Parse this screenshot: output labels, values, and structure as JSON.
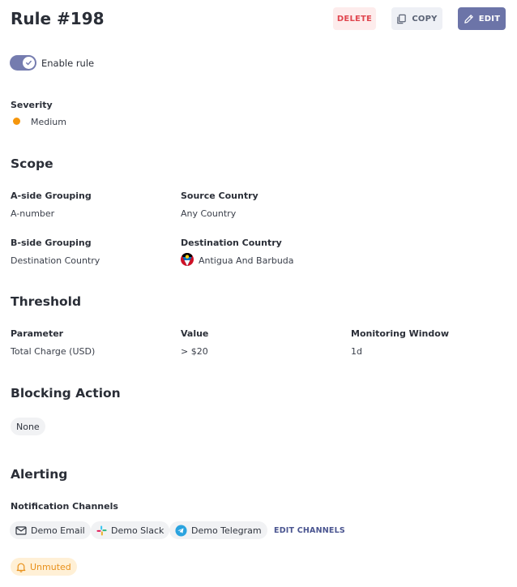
{
  "header": {
    "title": "Rule #198",
    "delete_label": "DELETE",
    "copy_label": "COPY",
    "edit_label": "EDIT"
  },
  "toggle": {
    "label": "Enable rule",
    "enabled": true
  },
  "severity": {
    "label": "Severity",
    "value": "Medium",
    "color": "#f5960c"
  },
  "scope": {
    "heading": "Scope",
    "a_side_label": "A-side Grouping",
    "a_side_value": "A-number",
    "source_country_label": "Source Country",
    "source_country_value": "Any Country",
    "b_side_label": "B-side Grouping",
    "b_side_value": "Destination Country",
    "destination_country_label": "Destination Country",
    "destination_country_value": "Antigua And Barbuda",
    "destination_flag_icon": "antigua-and-barbuda-flag-icon"
  },
  "threshold": {
    "heading": "Threshold",
    "parameter_label": "Parameter",
    "parameter_value": "Total Charge (USD)",
    "value_label": "Value",
    "value_value": "> $20",
    "window_label": "Monitoring Window",
    "window_value": "1d"
  },
  "blocking": {
    "heading": "Blocking Action",
    "value": "None"
  },
  "alerting": {
    "heading": "Alerting",
    "channels_label": "Notification Channels",
    "channels": [
      {
        "label": "Demo Email",
        "icon": "mail-icon"
      },
      {
        "label": "Demo Slack",
        "icon": "slack-icon"
      },
      {
        "label": "Demo Telegram",
        "icon": "telegram-icon"
      }
    ],
    "edit_channels_label": "EDIT CHANNELS",
    "mute_status": "Unmuted"
  },
  "colors": {
    "accent": "#6c74a8",
    "delete_text": "#e0464f",
    "delete_bg": "#fdecec",
    "unmuted_text": "#e8901a",
    "unmuted_bg": "#fff0d6"
  }
}
